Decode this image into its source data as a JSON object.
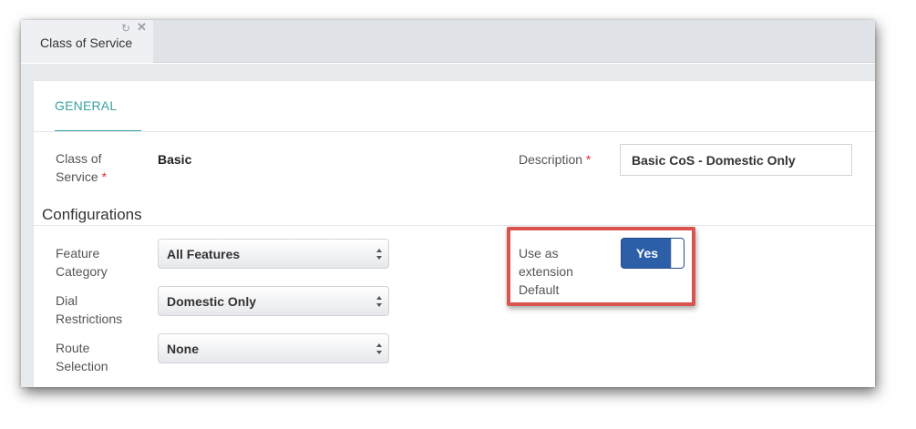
{
  "tab": {
    "title": "Class of Service",
    "refresh_icon": "refresh-icon",
    "close_icon": "close-icon"
  },
  "nav": {
    "tabs": [
      {
        "label": "GENERAL",
        "active": true
      }
    ],
    "accent": "#3aa3a0"
  },
  "general": {
    "class_of_service": {
      "label_line1": "Class of",
      "label_line2": "Service",
      "required_mark": "*",
      "value": "Basic"
    },
    "description": {
      "label": "Description",
      "required_mark": "*",
      "value": "Basic CoS - Domestic Only"
    }
  },
  "configurations": {
    "title": "Configurations",
    "feature_category": {
      "label_line1": "Feature",
      "label_line2": "Category",
      "selected": "All Features"
    },
    "dial_restrictions": {
      "label_line1": "Dial",
      "label_line2": "Restrictions",
      "selected": "Domestic Only"
    },
    "route_selection": {
      "label_line1": "Route",
      "label_line2": "Selection",
      "selected": "None"
    },
    "use_as_default": {
      "label_line1": "Use as",
      "label_line2": "extension",
      "label_line3": "Default",
      "toggle_label": "Yes",
      "on": true,
      "toggle_color": "#2d5ea8",
      "highlight_color": "#d9534f"
    }
  }
}
